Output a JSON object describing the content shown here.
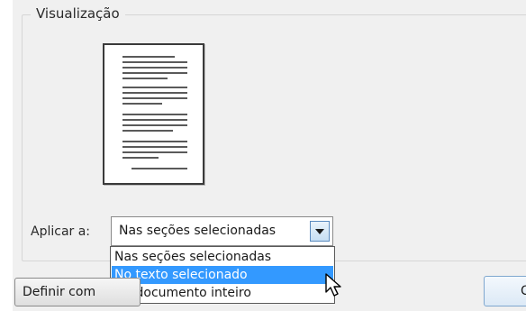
{
  "group": {
    "title": "Visualização"
  },
  "apply": {
    "label": "Aplicar a:",
    "selected": "Nas seções selecionadas",
    "options": [
      "Nas seções selecionadas",
      "No texto selecionado",
      "No documento inteiro"
    ],
    "highlighted_index": 1
  },
  "buttons": {
    "set_default_label": "Definir com",
    "right_label": "C"
  },
  "icons": {
    "dropdown": "chevron-down-icon",
    "cursor": "mouse-pointer-icon"
  },
  "colors": {
    "highlight": "#3399ff",
    "dialog_bg": "#f0f0f0"
  }
}
